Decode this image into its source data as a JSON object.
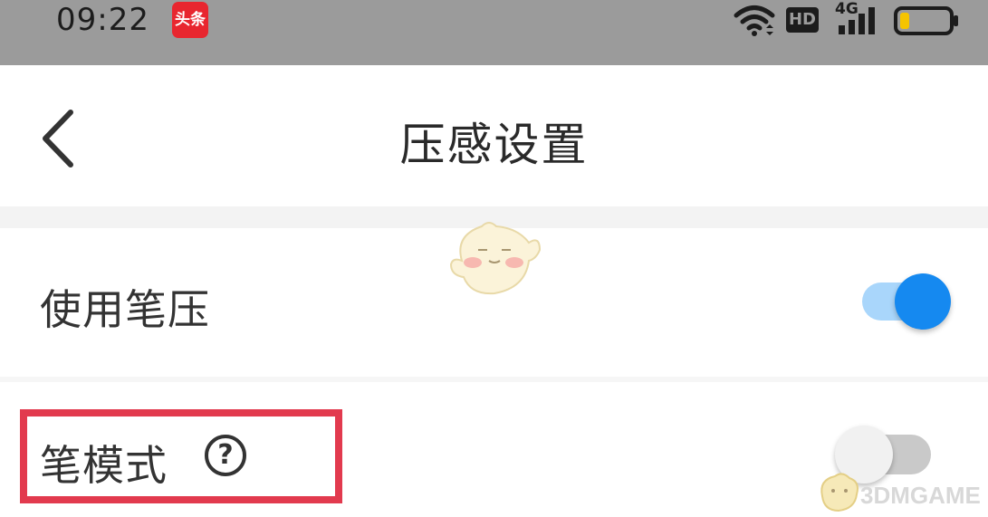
{
  "status_bar": {
    "time": "09:22",
    "app_badge": "头条",
    "network_type": "4G",
    "hd_label": "HD",
    "battery_level": 0.2,
    "icons": [
      "wifi-icon",
      "hd-icon",
      "signal-icon",
      "battery-icon"
    ]
  },
  "header": {
    "title": "压感设置",
    "back_icon": "chevron-left-icon"
  },
  "settings": [
    {
      "label": "使用笔压",
      "toggle_on": true
    },
    {
      "label": "笔模式",
      "toggle_on": false,
      "help_icon": "?"
    }
  ],
  "watermark": {
    "text": "3DMGAME"
  },
  "colors": {
    "accent": "#1589f0",
    "accent_light": "#a9d6fb",
    "highlight_border": "#e23a4e",
    "status_bar_bg": "#9b9b9b"
  }
}
